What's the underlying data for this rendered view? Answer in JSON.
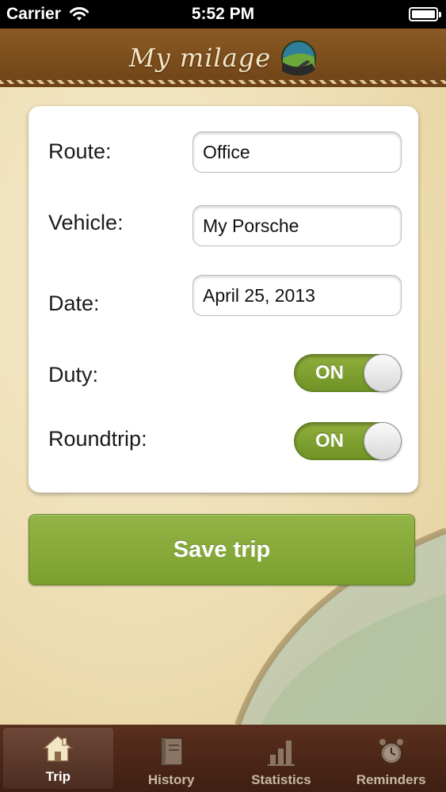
{
  "status_bar": {
    "carrier": "Carrier",
    "time": "5:52 PM"
  },
  "header": {
    "logo_text": "My milage"
  },
  "form": {
    "route": {
      "label": "Route:",
      "value": "Office"
    },
    "vehicle": {
      "label": "Vehicle:",
      "value": "My Porsche"
    },
    "date": {
      "label": "Date:",
      "value": "April 25, 2013"
    },
    "duty": {
      "label": "Duty:",
      "state": "ON"
    },
    "roundtrip": {
      "label": "Roundtrip:",
      "state": "ON"
    }
  },
  "save_button": {
    "label": "Save trip"
  },
  "tabs": [
    {
      "label": "Trip",
      "icon": "house-icon",
      "active": true
    },
    {
      "label": "History",
      "icon": "notebook-icon",
      "active": false
    },
    {
      "label": "Statistics",
      "icon": "bar-chart-icon",
      "active": false
    },
    {
      "label": "Reminders",
      "icon": "alarm-clock-icon",
      "active": false
    }
  ],
  "colors": {
    "accent_green": "#7ba02f",
    "header_brown": "#7a4c1c",
    "tabbar_brown": "#4a2616",
    "paper": "#efe0b8"
  }
}
